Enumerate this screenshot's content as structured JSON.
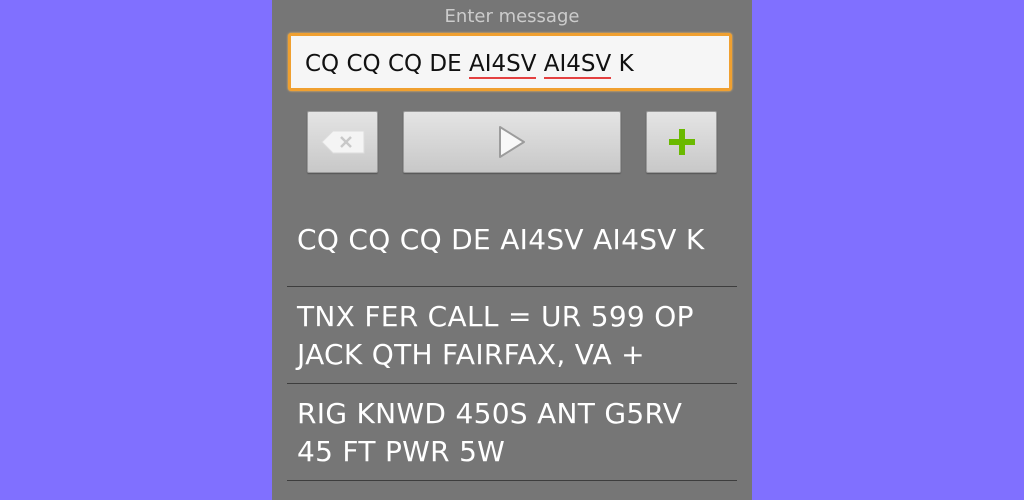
{
  "input": {
    "placeholder": "Enter message",
    "value_parts": [
      "CQ CQ CQ DE ",
      "AI4SV",
      " ",
      "AI4SV",
      " K"
    ]
  },
  "buttons": {
    "delete_icon": "backspace-icon",
    "play_icon": "play-icon",
    "add_icon": "plus-icon"
  },
  "messages": [
    {
      "line1": "CQ CQ CQ DE AI4SV AI4SV K",
      "line2": ""
    },
    {
      "line1": "TNX FER CALL = UR 599 OP",
      "line2": "JACK QTH FAIRFAX, VA +"
    },
    {
      "line1": "RIG KNWD 450S ANT G5RV",
      "line2": "45 FT PWR 5W"
    }
  ],
  "colors": {
    "background": "#8070ff",
    "panel": "#767676",
    "input_border": "#f0a030",
    "add_green": "#6ab900",
    "spellcheck": "#e34040"
  }
}
